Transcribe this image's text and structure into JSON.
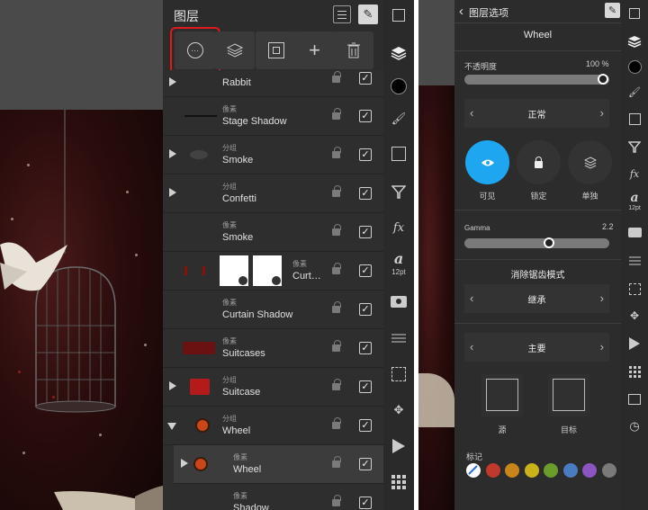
{
  "layers_panel": {
    "title": "图层",
    "toolbar": {
      "more_icon": "ellipsis-circle-icon",
      "layers_icon": "layers-stack-icon",
      "mask_icon": "mask-icon",
      "add_icon": "plus-icon",
      "delete_icon": "trash-icon"
    },
    "layers": [
      {
        "type": "",
        "name": "Rabbit",
        "expandable": true,
        "expanded": false
      },
      {
        "type": "像素",
        "name": "Stage Shadow",
        "expandable": false
      },
      {
        "type": "分组",
        "name": "Smoke",
        "expandable": true,
        "expanded": false
      },
      {
        "type": "分组",
        "name": "Confetti",
        "expandable": true,
        "expanded": false
      },
      {
        "type": "像素",
        "name": "Smoke",
        "expandable": false
      },
      {
        "type": "像素",
        "name": "Curt…",
        "expandable": false
      },
      {
        "type": "像素",
        "name": "Curtain Shadow",
        "expandable": false
      },
      {
        "type": "像素",
        "name": "Suitcases",
        "expandable": false
      },
      {
        "type": "分组",
        "name": "Suitcase",
        "expandable": true,
        "expanded": false
      },
      {
        "type": "分组",
        "name": "Wheel",
        "expandable": true,
        "expanded": true
      },
      {
        "type": "像素",
        "name": "Wheel",
        "expandable": true,
        "expanded": false
      },
      {
        "type": "像素",
        "name": "Shadow",
        "expandable": false
      }
    ]
  },
  "sidebar": {
    "icons": [
      "expand-icon",
      "layers-icon",
      "color-dot-icon",
      "brush-icon",
      "adjust-icon",
      "filter-icon",
      "fx-icon",
      "text-icon",
      "camera-icon",
      "sliders-icon",
      "crop-icon",
      "transform-icon",
      "play-icon",
      "grid-icon"
    ],
    "fx_label": "fx",
    "text_label": "a",
    "text_size": "12pt"
  },
  "options_panel": {
    "back_label": "图层选项",
    "layer_name": "Wheel",
    "opacity_label": "不透明度",
    "opacity_value": "100 %",
    "opacity": 1.0,
    "blend_mode": "正常",
    "visible_label": "可见",
    "lock_label": "锁定",
    "solo_label": "单独",
    "gamma_label": "Gamma",
    "gamma_value": "2.2",
    "gamma_fraction": 0.6,
    "antialias_title": "消除锯齿模式",
    "antialias_value": "继承",
    "channel_value": "主要",
    "source_label": "源",
    "target_label": "目标",
    "tags_label": "标记",
    "tag_colors": [
      "none",
      "#c0392b",
      "#c8861a",
      "#c9b21a",
      "#6b9d2a",
      "#4a7ac0",
      "#8a55c0",
      "#7a7a7a"
    ]
  },
  "accent_color": "#1ea7f0",
  "highlight_color": "#e0191b"
}
